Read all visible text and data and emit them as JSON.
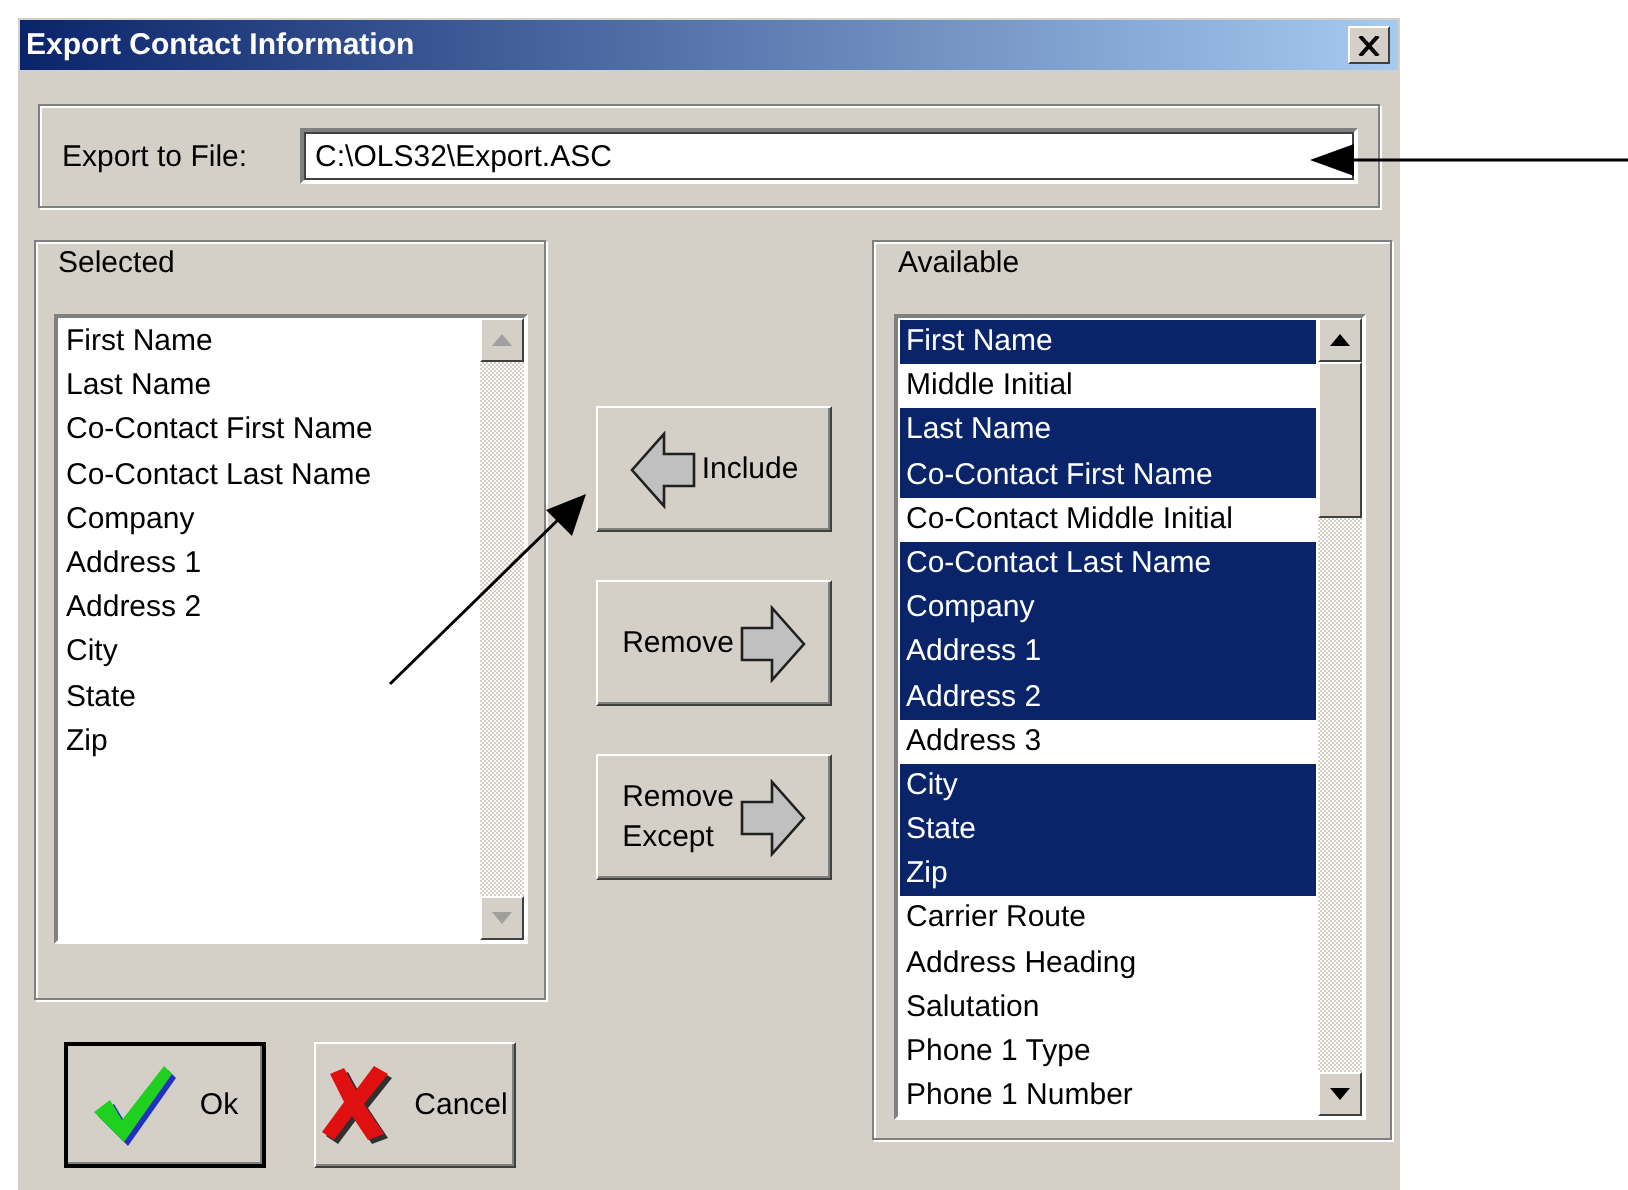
{
  "window": {
    "title": "Export Contact Information"
  },
  "export_file": {
    "label": "Export to File:",
    "value": "C:\\OLS32\\Export.ASC"
  },
  "selected_list": {
    "label": "Selected",
    "scroll_enabled": false,
    "items": [
      {
        "text": "First Name",
        "selected": false
      },
      {
        "text": "Last Name",
        "selected": false
      },
      {
        "text": "Co-Contact First Name",
        "selected": false
      },
      {
        "text": "Co-Contact Last Name",
        "selected": false
      },
      {
        "text": "Company",
        "selected": false
      },
      {
        "text": "Address 1",
        "selected": false
      },
      {
        "text": "Address 2",
        "selected": false
      },
      {
        "text": "City",
        "selected": false
      },
      {
        "text": "State",
        "selected": false
      },
      {
        "text": "Zip",
        "selected": false
      }
    ]
  },
  "transfer_buttons": [
    {
      "label": "Include",
      "kind": "left"
    },
    {
      "label": "Remove",
      "kind": "right"
    },
    {
      "label": "Remove Except",
      "kind": "right"
    }
  ],
  "available_list": {
    "label": "Available",
    "scroll_enabled": true,
    "items": [
      {
        "text": "First Name",
        "selected": true
      },
      {
        "text": "Middle Initial",
        "selected": false
      },
      {
        "text": "Last Name",
        "selected": true
      },
      {
        "text": "Co-Contact First Name",
        "selected": true
      },
      {
        "text": "Co-Contact Middle Initial",
        "selected": false
      },
      {
        "text": "Co-Contact Last Name",
        "selected": true
      },
      {
        "text": "Company",
        "selected": true
      },
      {
        "text": "Address 1",
        "selected": true
      },
      {
        "text": "Address 2",
        "selected": true
      },
      {
        "text": "Address 3",
        "selected": false
      },
      {
        "text": "City",
        "selected": true
      },
      {
        "text": "State",
        "selected": true
      },
      {
        "text": "Zip",
        "selected": true
      },
      {
        "text": "Carrier Route",
        "selected": false
      },
      {
        "text": "Address Heading",
        "selected": false
      },
      {
        "text": "Salutation",
        "selected": false
      },
      {
        "text": "Phone 1 Type",
        "selected": false
      },
      {
        "text": "Phone 1 Number",
        "selected": false
      }
    ]
  },
  "dialog_buttons": [
    {
      "label": "Ok",
      "kind": "ok",
      "default": true
    },
    {
      "label": "Cancel",
      "kind": "cancel",
      "default": false
    }
  ]
}
